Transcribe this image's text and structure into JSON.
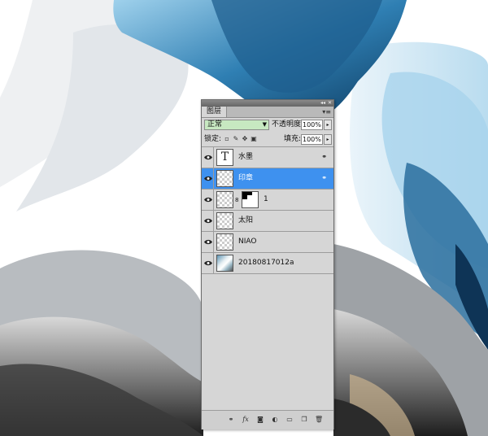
{
  "panel": {
    "tab_label": "图层",
    "topbar_controls": [
      "◂◂",
      "✕"
    ],
    "menu_icon": "panel-menu-icon"
  },
  "blend": {
    "mode": "正常",
    "opacity_label": "不透明度:",
    "opacity_value": "100%"
  },
  "lock": {
    "label": "锁定:",
    "fill_label": "填充:",
    "fill_value": "100%"
  },
  "layers": [
    {
      "name": "水墨",
      "kind": "text",
      "visible": true,
      "selected": false,
      "has_fx": true
    },
    {
      "name": "印章",
      "kind": "raster",
      "visible": true,
      "selected": true,
      "has_fx": true
    },
    {
      "name": "1",
      "kind": "mask",
      "visible": true,
      "selected": false,
      "has_fx": false
    },
    {
      "name": "太阳",
      "kind": "raster",
      "visible": true,
      "selected": false,
      "has_fx": false
    },
    {
      "name": "NIAO",
      "kind": "raster",
      "visible": true,
      "selected": false,
      "has_fx": false
    },
    {
      "name": "20180817012a",
      "kind": "photo",
      "visible": true,
      "selected": false,
      "has_fx": false
    }
  ],
  "bottom_icons": [
    "link-layers-icon",
    "fx-icon",
    "add-mask-icon",
    "adjustment-layer-icon",
    "group-folder-icon",
    "new-layer-icon",
    "trash-icon"
  ],
  "colors": {
    "selection": "#3e91ef",
    "blend_field": "#c7e8c1",
    "panel_bg": "#d6d6d6"
  }
}
